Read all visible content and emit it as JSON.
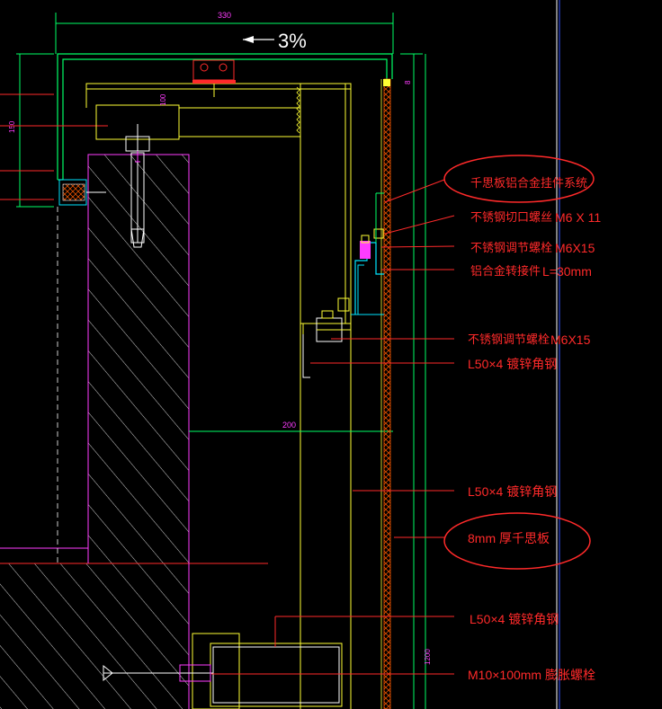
{
  "drawing": {
    "slope_label": "3%",
    "dimensions": {
      "top_width": "330",
      "left_height": "150",
      "small_top": "100",
      "right_small": "8",
      "middle_width": "200",
      "right_height": "1200"
    },
    "labels": [
      {
        "id": "system",
        "text": "千思板铝合金挂件系统",
        "spec": ""
      },
      {
        "id": "cut-bolt",
        "text": "不锈钢切口螺丝",
        "spec": "M6 X 11"
      },
      {
        "id": "adjust-bolt-1",
        "text": "不锈钢调节螺栓",
        "spec": "M6X15"
      },
      {
        "id": "adapter",
        "text": "铝合金转接件",
        "spec": "L=30mm"
      },
      {
        "id": "adjust-bolt-2",
        "text": "不锈钢调节螺栓",
        "spec": "M6X15"
      },
      {
        "id": "angle-1",
        "text": "L50×4  镀锌角钢",
        "spec": ""
      },
      {
        "id": "angle-2",
        "text": "L50×4  镀锌角钢",
        "spec": ""
      },
      {
        "id": "panel",
        "text": "8mm 厚千思板",
        "spec": ""
      },
      {
        "id": "angle-3",
        "text": "L50×4  镀锌角钢",
        "spec": ""
      },
      {
        "id": "anchor",
        "text": "M10×100mm  膨胀螺栓",
        "spec": ""
      }
    ],
    "colors": {
      "background": "#000000",
      "green": "#00ff66",
      "yellow": "#ffff33",
      "magenta": "#ff3cff",
      "red": "#ff2a2a",
      "white": "#ffffff",
      "cyan": "#00e5ff",
      "blue": "#3355ff",
      "orange": "#ff8800"
    }
  }
}
